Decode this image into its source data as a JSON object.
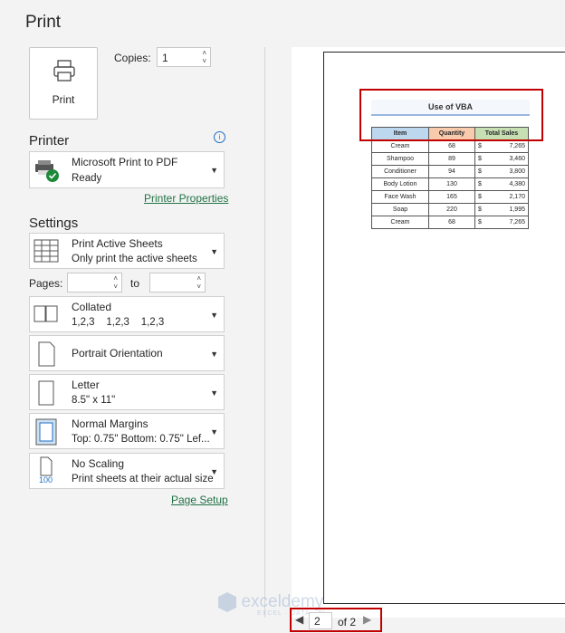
{
  "header": {
    "title": "Print"
  },
  "print_button": {
    "label": "Print"
  },
  "copies": {
    "label": "Copies:",
    "value": "1"
  },
  "printer": {
    "section": "Printer",
    "name": "Microsoft Print to PDF",
    "status": "Ready",
    "properties_link": "Printer Properties"
  },
  "settings": {
    "section": "Settings",
    "sheets": {
      "line1": "Print Active Sheets",
      "line2": "Only print the active sheets"
    },
    "pages": {
      "label": "Pages:",
      "to_label": "to",
      "from_value": "",
      "to_value": ""
    },
    "collation": {
      "line1": "Collated",
      "line2": "1,2,3    1,2,3    1,2,3"
    },
    "orientation": {
      "line1": "Portrait Orientation"
    },
    "paper": {
      "line1": "Letter",
      "line2": "8.5\" x 11\""
    },
    "margins": {
      "line1": "Normal Margins",
      "line2": "Top: 0.75\" Bottom: 0.75\" Lef..."
    },
    "scaling": {
      "line1": "No Scaling",
      "line2": "Print sheets at their actual size",
      "icon_text": "100"
    },
    "page_setup_link": "Page Setup"
  },
  "preview": {
    "sheet_title": "Use of VBA",
    "columns": [
      "Item",
      "Quantity",
      "Total Sales"
    ],
    "column_colors": [
      "#bdd7ee",
      "#f8cbad",
      "#c6e0b4"
    ],
    "rows": [
      {
        "item": "Cream",
        "qty": "68",
        "cur": "$",
        "sales": "7,265"
      },
      {
        "item": "Shampoo",
        "qty": "89",
        "cur": "$",
        "sales": "3,460"
      },
      {
        "item": "Conditioner",
        "qty": "94",
        "cur": "$",
        "sales": "3,800"
      },
      {
        "item": "Body Lotion",
        "qty": "130",
        "cur": "$",
        "sales": "4,380"
      },
      {
        "item": "Face Wash",
        "qty": "165",
        "cur": "$",
        "sales": "2,170"
      },
      {
        "item": "Soap",
        "qty": "220",
        "cur": "$",
        "sales": "1,995"
      },
      {
        "item": "Cream",
        "qty": "68",
        "cur": "$",
        "sales": "7,265"
      }
    ]
  },
  "pager": {
    "current": "2",
    "of_label": "of 2"
  },
  "watermark": {
    "brand": "exceldemy",
    "tagline": "EXCEL · DATA · BI"
  },
  "colors": {
    "link": "#217346",
    "highlight": "#c00000",
    "info": "#1f6fc5"
  }
}
